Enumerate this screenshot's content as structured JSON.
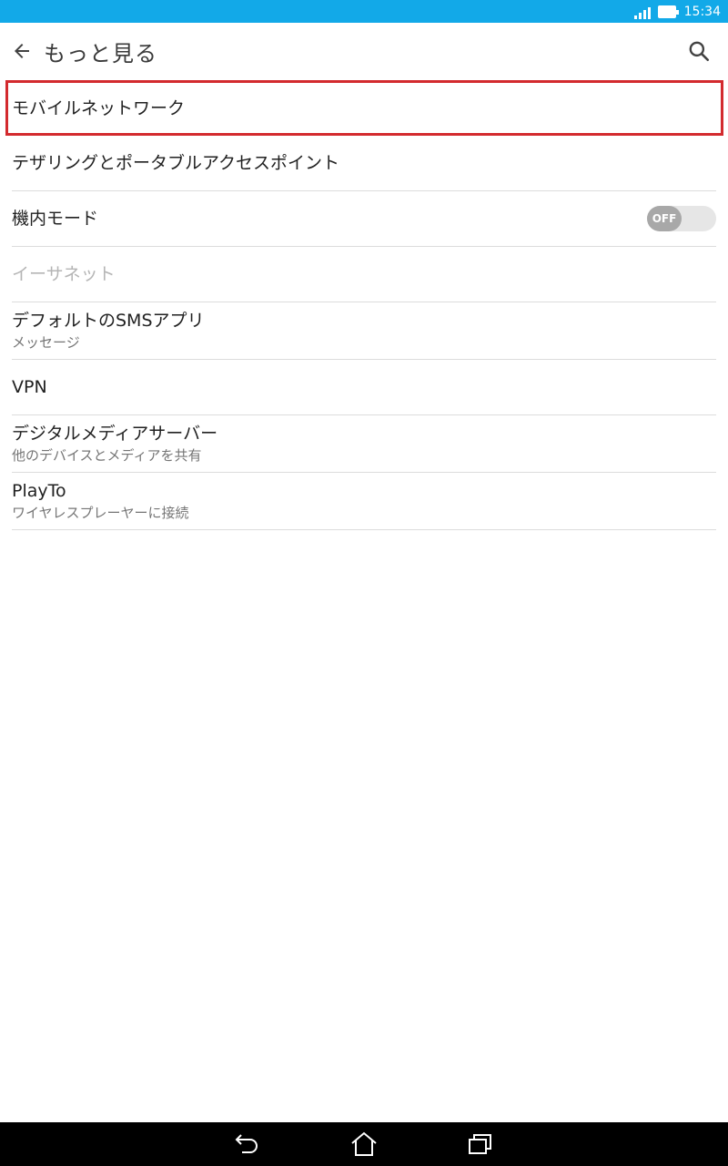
{
  "status_bar": {
    "time": "15:34",
    "signal_icon": "signal-icon",
    "battery_icon": "battery-icon"
  },
  "app_bar": {
    "title": "もっと見る",
    "back_icon": "arrow-back-icon",
    "search_icon": "search-icon"
  },
  "items": [
    {
      "title": "モバイルネットワーク",
      "highlighted": true
    },
    {
      "title": "テザリングとポータブルアクセスポイント"
    },
    {
      "title": "機内モード",
      "toggle": "OFF",
      "toggle_on": false
    },
    {
      "title": "イーサネット",
      "disabled": true
    },
    {
      "title": "デフォルトのSMSアプリ",
      "summary": "メッセージ"
    },
    {
      "title": "VPN"
    },
    {
      "title": "デジタルメディアサーバー",
      "summary": "他のデバイスとメディアを共有"
    },
    {
      "title": "PlayTo",
      "summary": "ワイヤレスプレーヤーに接続"
    }
  ],
  "nav_bar": {
    "back_icon": "nav-back-icon",
    "home_icon": "nav-home-icon",
    "recents_icon": "nav-recents-icon"
  },
  "colors": {
    "status_bar": "#12a9e8",
    "highlight": "#d32a2e",
    "nav_bar": "#000000"
  }
}
